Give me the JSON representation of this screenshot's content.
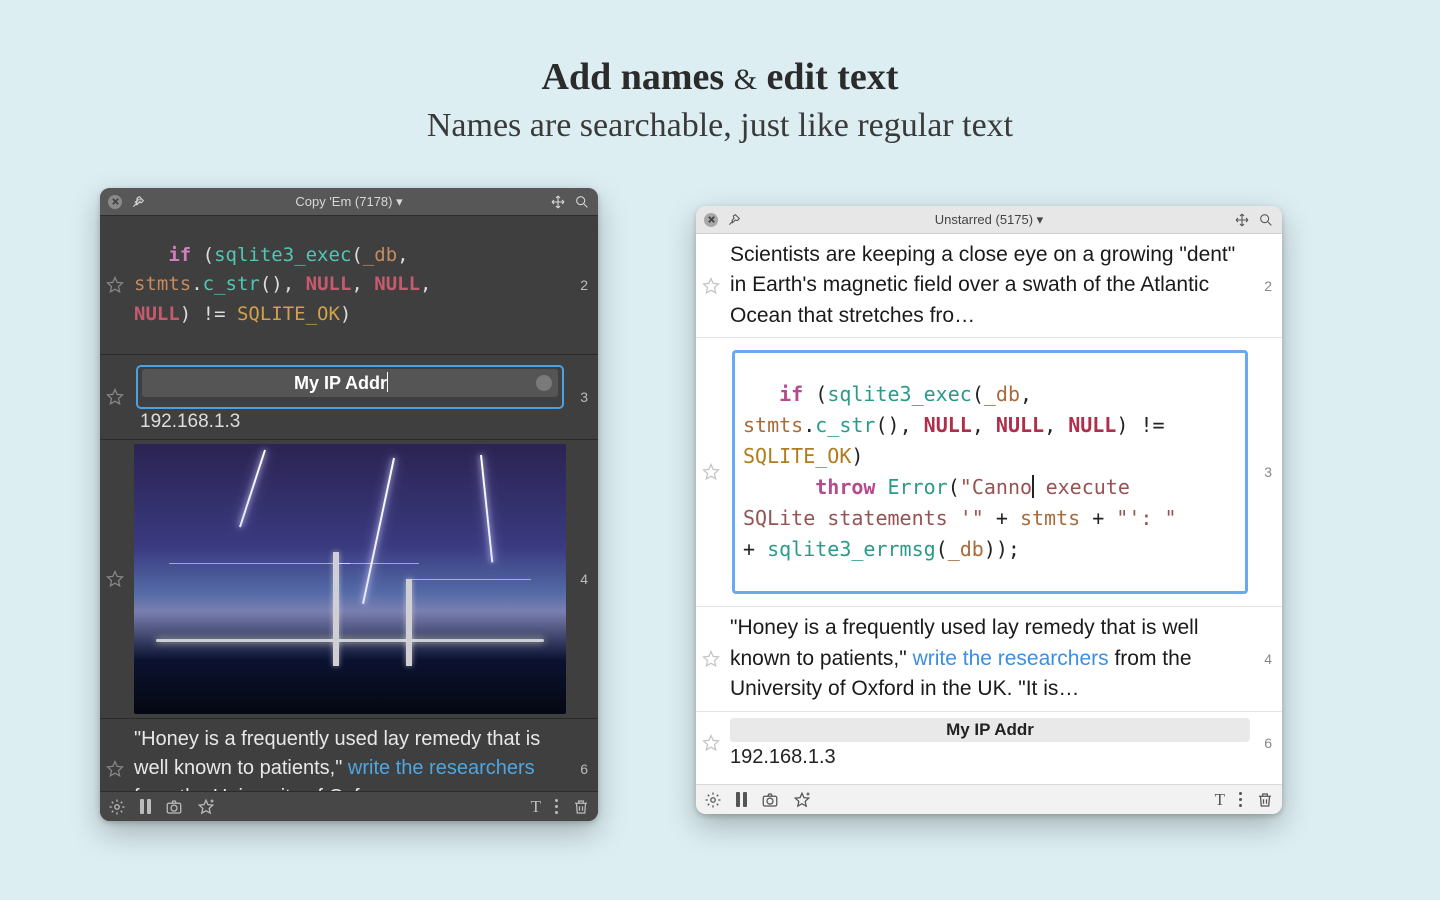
{
  "headline": {
    "main_left": "Add names",
    "amp": "&",
    "main_right": "edit text",
    "sub": "Names are searchable, just like regular text"
  },
  "dark_window": {
    "title": "Copy 'Em (7178) ▾",
    "items": {
      "code": {
        "index": "2",
        "tokens": "   <kw>if</kw> (<fn>sqlite3_exec</fn>(<var>_db</var>,\n<var>stmts</var>.<fn>c_str</fn>(), <null>NULL</null>, <null>NULL</null>,\n<null>NULL</null>) != <const>SQLITE_OK</const>)"
      },
      "named": {
        "index": "3",
        "name_value": "My IP Addr",
        "ip": "192.168.1.3"
      },
      "image": {
        "index": "4"
      },
      "honey": {
        "index": "6",
        "pre": "\"Honey is a frequently used lay remedy that is well known to patients,\" ",
        "link": "write the researchers",
        "post": " from the University of Oxf…"
      }
    }
  },
  "light_window": {
    "title": "Unstarred (5175) ▾",
    "items": {
      "scientists": {
        "index": "2",
        "text": "Scientists are keeping a close eye on a growing \"dent\" in Earth's magnetic field over a swath of the Atlantic Ocean that stretches fro…"
      },
      "code_edit": {
        "index": "3",
        "tokens_pre": "   <kw>if</kw> (<fn>sqlite3_exec</fn>(<var>_db</var>,\n<var>stmts</var>.<fn>c_str</fn>(), <null>NULL</null>, <null>NULL</null>, <null>NULL</null>) !=\n<const>SQLITE_OK</const>)\n      <kw>throw</kw> <fn>Error</fn>(<str>\"Canno</str>",
        "tokens_post": "<str> execute\nSQLite statements '\"</str> + <var>stmts</var> + <str>\"': \"</str>\n+ <fn>sqlite3_errmsg</fn>(<var>_db</var>));"
      },
      "honey": {
        "index": "4",
        "pre": "\"Honey is a frequently used lay remedy that is well known to patients,\" ",
        "link": "write the researchers",
        "post": " from the University of Oxford in the UK. \"It is…"
      },
      "named": {
        "index": "6",
        "name": "My IP Addr",
        "ip": "192.168.1.3"
      }
    }
  }
}
